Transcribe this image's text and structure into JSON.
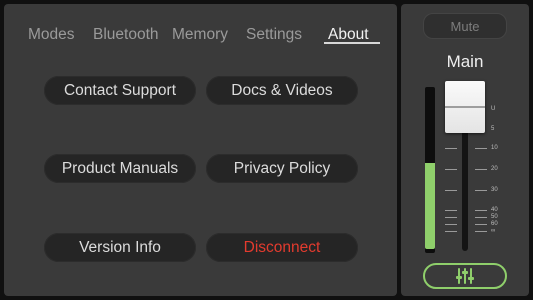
{
  "tabs": [
    {
      "label": "Modes",
      "active": false
    },
    {
      "label": "Bluetooth",
      "active": false
    },
    {
      "label": "Memory",
      "active": false
    },
    {
      "label": "Settings",
      "active": false
    },
    {
      "label": "About",
      "active": true
    }
  ],
  "about": {
    "contact_support": "Contact Support",
    "docs_videos": "Docs & Videos",
    "product_manuals": "Product Manuals",
    "privacy_policy": "Privacy Policy",
    "version_info": "Version Info",
    "disconnect": "Disconnect"
  },
  "channel": {
    "mute_label": "Mute",
    "name": "Main",
    "meter_level": 0.52,
    "scale_labels": [
      "U",
      "5",
      "10",
      "20",
      "30",
      "40",
      "50",
      "60",
      "∞"
    ],
    "mixer_icon": "sliders-icon"
  },
  "colors": {
    "accent": "#8fcf6b",
    "danger": "#e33b2e",
    "panel": "#3a3a3a",
    "button": "#252525"
  }
}
